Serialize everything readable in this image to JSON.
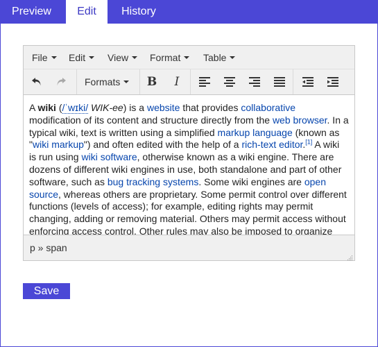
{
  "tabs": {
    "preview": "Preview",
    "edit": "Edit",
    "history": "History",
    "active": "Edit"
  },
  "menu": {
    "file": "File",
    "edit": "Edit",
    "view": "View",
    "format": "Format",
    "table": "Table"
  },
  "toolbar": {
    "formats_label": "Formats",
    "bold_glyph": "B",
    "italic_glyph": "I",
    "icons": [
      "undo-icon",
      "redo-icon",
      "bold-icon",
      "italic-icon",
      "align-left-icon",
      "align-center-icon",
      "align-right-icon",
      "align-justify-icon",
      "outdent-icon",
      "indent-icon"
    ]
  },
  "content": {
    "segments": [
      {
        "t": "A ",
        "k": "text"
      },
      {
        "t": "wiki",
        "k": "bold"
      },
      {
        "t": " (",
        "k": "text"
      },
      {
        "t": "/ˈwɪki/",
        "k": "ipa"
      },
      {
        "t": " ",
        "k": "text"
      },
      {
        "t": "WIK-ee",
        "k": "italic"
      },
      {
        "t": ") is a ",
        "k": "text"
      },
      {
        "t": "website",
        "k": "link"
      },
      {
        "t": " that provides ",
        "k": "text"
      },
      {
        "t": "collaborative",
        "k": "link"
      },
      {
        "t": " modification of its content and structure directly from the ",
        "k": "text"
      },
      {
        "t": "web browser",
        "k": "link"
      },
      {
        "t": ". In a typical wiki, text is written using a simplified ",
        "k": "text"
      },
      {
        "t": "markup language",
        "k": "link"
      },
      {
        "t": " (known as \"",
        "k": "text"
      },
      {
        "t": "wiki markup",
        "k": "link"
      },
      {
        "t": "\") and often edited with the help of a ",
        "k": "text"
      },
      {
        "t": "rich-text editor",
        "k": "link"
      },
      {
        "t": ".",
        "k": "text"
      },
      {
        "t": "[1]",
        "k": "sup"
      },
      {
        "t": " A wiki is run using ",
        "k": "text"
      },
      {
        "t": "wiki software",
        "k": "link"
      },
      {
        "t": ", otherwise known as a wiki engine. There are dozens of different wiki engines in use, both standalone and part of other software, such as ",
        "k": "text"
      },
      {
        "t": "bug tracking systems",
        "k": "link"
      },
      {
        "t": ". Some wiki engines are ",
        "k": "text"
      },
      {
        "t": "open source",
        "k": "link"
      },
      {
        "t": ", whereas others are proprietary. Some permit control over different functions (levels of access); for example, editing rights may permit changing, adding or removing material. Others may permit access without enforcing access control. Other rules may also be imposed to organize content.",
        "k": "text"
      }
    ]
  },
  "status": {
    "path": "p » span"
  },
  "actions": {
    "save": "Save"
  },
  "colors": {
    "accent": "#4b47d6",
    "link": "#0645ad",
    "toolbar_bg": "#f0f0f0"
  }
}
